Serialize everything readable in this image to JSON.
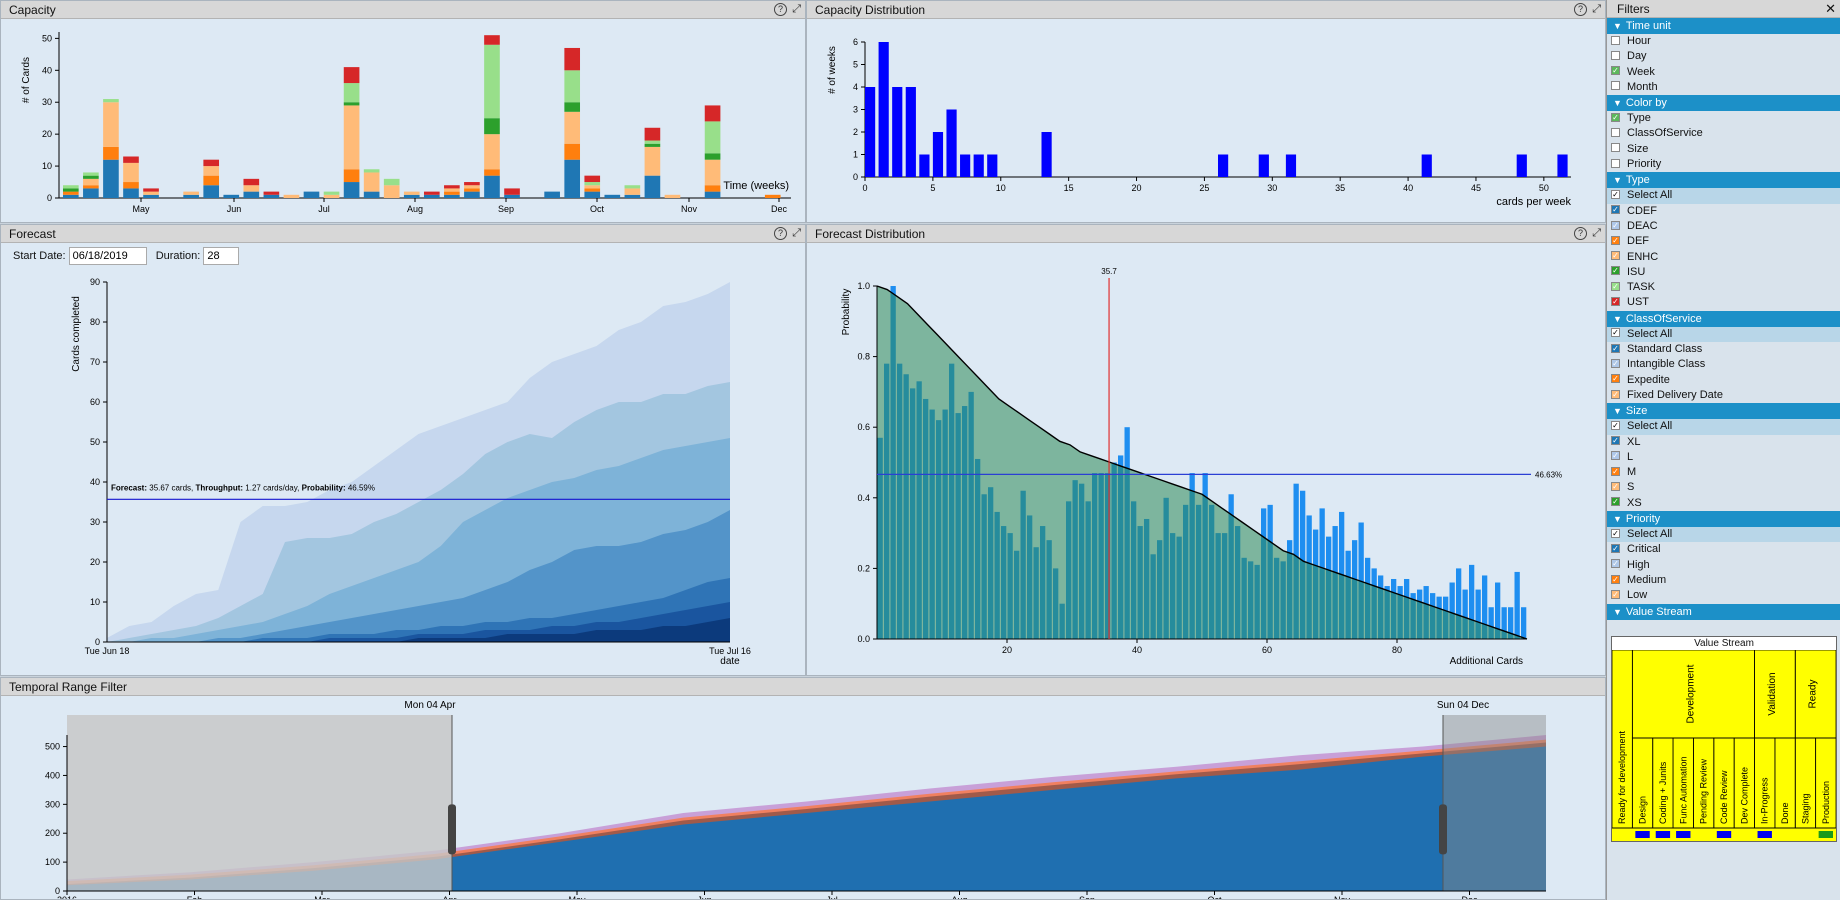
{
  "capacity": {
    "title": "Capacity",
    "ylabel": "# of Cards",
    "xlabel": "Time (weeks)",
    "yticks": [
      0,
      10,
      20,
      30,
      40,
      50
    ],
    "months": [
      "May",
      "Jun",
      "Jul",
      "Aug",
      "Sep",
      "Oct",
      "Nov",
      "Dec"
    ]
  },
  "capacity_distribution": {
    "title": "Capacity Distribution",
    "ylabel": "# of weeks",
    "xlabel": "cards per week",
    "xticks": [
      0,
      5,
      10,
      15,
      20,
      25,
      30,
      35,
      40,
      45,
      50
    ],
    "yticks": [
      0,
      1,
      2,
      3,
      4,
      5,
      6
    ]
  },
  "forecast": {
    "title": "Forecast",
    "start_date_label": "Start Date:",
    "start_date": "06/18/2019",
    "duration_label": "Duration:",
    "duration": "28",
    "ylabel": "Cards completed",
    "xlabel": "date",
    "x_start": "Tue Jun 18",
    "x_end": "Tue Jul 16",
    "yticks": [
      0,
      10,
      20,
      30,
      40,
      50,
      60,
      70,
      80,
      90
    ],
    "annotation": {
      "forecast_label": "Forecast:",
      "forecast_value": "35.67 cards,",
      "throughput_label": "Throughput:",
      "throughput_value": "1.27 cards/day,",
      "probability_label": "Probability:",
      "probability_value": "46.59%"
    }
  },
  "forecast_distribution": {
    "title": "Forecast Distribution",
    "ylabel": "Probability",
    "xlabel": "Additional Cards",
    "xticks": [
      20,
      40,
      60,
      80
    ],
    "yticks": [
      "0.0",
      "0.2",
      "0.4",
      "0.6",
      "0.8",
      "1.0"
    ],
    "marker_label": "35.7",
    "hline_label": "46.63%"
  },
  "temporal": {
    "title": "Temporal Range Filter",
    "range_start": "Mon 04 Apr",
    "range_end": "Sun 04 Dec",
    "yticks": [
      0,
      100,
      200,
      300,
      400,
      500
    ],
    "xticks": [
      "2016",
      "Feb",
      "Mar",
      "Apr",
      "May",
      "Jun",
      "Jul",
      "Aug",
      "Sep",
      "Oct",
      "Nov",
      "Dec"
    ]
  },
  "filters": {
    "title": "Filters",
    "groups": [
      {
        "title": "Time unit",
        "items": [
          {
            "label": "Hour",
            "color": "#ffffff"
          },
          {
            "label": "Day",
            "color": "#ffffff"
          },
          {
            "label": "Week",
            "color": "#5cb85c",
            "checked": true
          },
          {
            "label": "Month",
            "color": "#ffffff"
          }
        ]
      },
      {
        "title": "Color by",
        "items": [
          {
            "label": "Type",
            "color": "#5cb85c",
            "checked": true
          },
          {
            "label": "ClassOfService",
            "color": "#ffffff"
          },
          {
            "label": "Size",
            "color": "#ffffff"
          },
          {
            "label": "Priority",
            "color": "#ffffff"
          }
        ]
      },
      {
        "title": "Type",
        "items": [
          {
            "label": "Select All",
            "sel": true,
            "checked": true
          },
          {
            "label": "CDEF",
            "color": "#1f77b4",
            "checked": true
          },
          {
            "label": "DEAC",
            "color": "#aec7e8",
            "checked": true
          },
          {
            "label": "DEF",
            "color": "#ff7f0e",
            "checked": true
          },
          {
            "label": "ENHC",
            "color": "#ffbb78",
            "checked": true
          },
          {
            "label": "ISU",
            "color": "#2ca02c",
            "checked": true
          },
          {
            "label": "TASK",
            "color": "#98df8a",
            "checked": true
          },
          {
            "label": "UST",
            "color": "#d62728",
            "checked": true
          }
        ]
      },
      {
        "title": "ClassOfService",
        "items": [
          {
            "label": "Select All",
            "sel": true,
            "checked": true
          },
          {
            "label": "Standard Class",
            "color": "#1f77b4",
            "checked": true
          },
          {
            "label": "Intangible Class",
            "color": "#aec7e8",
            "checked": true
          },
          {
            "label": "Expedite",
            "color": "#ff7f0e",
            "checked": true
          },
          {
            "label": "Fixed Delivery Date",
            "color": "#ffbb78",
            "checked": true
          }
        ]
      },
      {
        "title": "Size",
        "items": [
          {
            "label": "Select All",
            "sel": true,
            "checked": true
          },
          {
            "label": "XL",
            "color": "#1f77b4",
            "checked": true
          },
          {
            "label": "L",
            "color": "#aec7e8",
            "checked": true
          },
          {
            "label": "M",
            "color": "#ff7f0e",
            "checked": true
          },
          {
            "label": "S",
            "color": "#ffbb78",
            "checked": true
          },
          {
            "label": "XS",
            "color": "#2ca02c",
            "checked": true
          }
        ]
      },
      {
        "title": "Priority",
        "items": [
          {
            "label": "Select All",
            "sel": true,
            "checked": true
          },
          {
            "label": "Critical",
            "color": "#1f77b4",
            "checked": true
          },
          {
            "label": "High",
            "color": "#aec7e8",
            "checked": true
          },
          {
            "label": "Medium",
            "color": "#ff7f0e",
            "checked": true
          },
          {
            "label": "Low",
            "color": "#ffbb78",
            "checked": true
          }
        ]
      },
      {
        "title": "Value Stream",
        "items": []
      }
    ]
  },
  "value_stream": {
    "title": "Value Stream",
    "groups": [
      "Development",
      "Validation",
      "Ready"
    ],
    "columns": [
      "Ready for development",
      "Design",
      "Coding + Junits",
      "Func Automation",
      "Pending Review",
      "Code Review",
      "Dev Complete",
      "In-Progress",
      "Done",
      "Staging",
      "Production"
    ],
    "markers": [
      0,
      1,
      1,
      1,
      0,
      1,
      0,
      1,
      0,
      0,
      2
    ]
  },
  "chart_data": [
    {
      "type": "bar",
      "title": "Capacity",
      "ylabel": "# of Cards",
      "xlabel": "Time (weeks)",
      "ylim": [
        0,
        52
      ],
      "series_names": [
        "CDEF",
        "DEF",
        "ENHC",
        "ISU",
        "TASK",
        "UST"
      ],
      "colors": [
        "#1f77b4",
        "#ff7f0e",
        "#ffbb78",
        "#2ca02c",
        "#98df8a",
        "#d62728"
      ],
      "weeks": [
        [
          1,
          1,
          0,
          1,
          1,
          0
        ],
        [
          3,
          1,
          2,
          1,
          1,
          0
        ],
        [
          12,
          4,
          14,
          0,
          1,
          0
        ],
        [
          3,
          2,
          6,
          0,
          0,
          2
        ],
        [
          1,
          0,
          1,
          0,
          0,
          1
        ],
        [
          0,
          0,
          0,
          0,
          0,
          0
        ],
        [
          1,
          0,
          1,
          0,
          0,
          0
        ],
        [
          4,
          3,
          3,
          0,
          0,
          2
        ],
        [
          1,
          0,
          0,
          0,
          0,
          0
        ],
        [
          2,
          0,
          2,
          0,
          0,
          2
        ],
        [
          1,
          0,
          0,
          0,
          0,
          1
        ],
        [
          0,
          0,
          1,
          0,
          0,
          0
        ],
        [
          2,
          0,
          0,
          0,
          0,
          0
        ],
        [
          0,
          0,
          1,
          0,
          1,
          0
        ],
        [
          5,
          4,
          20,
          1,
          6,
          5
        ],
        [
          2,
          0,
          6,
          0,
          1,
          0
        ],
        [
          0,
          0,
          4,
          0,
          2,
          0
        ],
        [
          1,
          0,
          1,
          0,
          0,
          0
        ],
        [
          1,
          0,
          0,
          0,
          0,
          1
        ],
        [
          1,
          1,
          1,
          0,
          0,
          1
        ],
        [
          2,
          1,
          1,
          0,
          0,
          1
        ],
        [
          7,
          2,
          11,
          5,
          23,
          3
        ],
        [
          1,
          0,
          0,
          0,
          0,
          2
        ],
        [
          0,
          0,
          0,
          0,
          0,
          0
        ],
        [
          2,
          0,
          0,
          0,
          0,
          0
        ],
        [
          12,
          5,
          10,
          3,
          10,
          7
        ],
        [
          2,
          1,
          1,
          0,
          1,
          2
        ],
        [
          1,
          0,
          0,
          0,
          0,
          0
        ],
        [
          1,
          0,
          2,
          0,
          1,
          0
        ],
        [
          7,
          0,
          9,
          1,
          1,
          4
        ],
        [
          0,
          0,
          1,
          0,
          0,
          0
        ],
        [
          0,
          0,
          0,
          0,
          0,
          0
        ],
        [
          2,
          2,
          8,
          2,
          10,
          5
        ],
        [
          0,
          0,
          0,
          0,
          0,
          0
        ],
        [
          0,
          0,
          0,
          0,
          0,
          0
        ],
        [
          0,
          1,
          0,
          0,
          0,
          0
        ]
      ]
    },
    {
      "type": "bar",
      "title": "Capacity Distribution",
      "ylabel": "# of weeks",
      "xlabel": "cards per week",
      "xlim": [
        0,
        52
      ],
      "ylim": [
        0,
        6
      ],
      "x": [
        0,
        1,
        2,
        3,
        4,
        5,
        6,
        7,
        8,
        9,
        13,
        26,
        29,
        31,
        41,
        48,
        51
      ],
      "values": [
        4,
        6,
        4,
        4,
        1,
        2,
        3,
        1,
        1,
        1,
        2,
        1,
        1,
        1,
        1,
        1,
        1
      ]
    },
    {
      "type": "area",
      "title": "Forecast",
      "ylabel": "Cards completed",
      "xlabel": "date",
      "ylim": [
        0,
        90
      ],
      "x": [
        0,
        1,
        2,
        3,
        4,
        5,
        6,
        7,
        8,
        9,
        10,
        11,
        12,
        13,
        14,
        15,
        16,
        17,
        18,
        19,
        20,
        21,
        22,
        23,
        24,
        25,
        26,
        27,
        28
      ],
      "bands": [
        [
          1,
          4,
          5,
          9,
          12,
          13,
          30,
          34,
          34,
          35,
          38,
          40,
          44,
          48,
          52,
          54,
          56,
          58,
          60,
          66,
          70,
          72,
          74,
          78,
          80,
          84,
          85,
          87,
          90
        ],
        [
          0,
          1,
          2,
          3,
          4,
          6,
          9,
          12,
          25,
          26,
          26,
          27,
          30,
          32,
          35,
          38,
          42,
          47,
          50,
          52,
          51,
          55,
          58,
          60,
          60,
          62,
          62,
          64,
          65
        ],
        [
          0,
          0,
          1,
          1,
          2,
          3,
          4,
          5,
          7,
          9,
          12,
          14,
          16,
          18,
          20,
          24,
          30,
          33,
          36,
          38,
          40,
          41,
          43,
          44,
          46,
          48,
          49,
          50,
          51
        ],
        [
          0,
          0,
          0,
          0,
          0,
          1,
          1,
          2,
          3,
          4,
          5,
          6,
          7,
          8,
          9,
          10,
          11,
          13,
          15,
          18,
          20,
          23,
          24,
          24,
          25,
          27,
          28,
          30,
          33
        ],
        [
          0,
          0,
          0,
          0,
          0,
          0,
          0,
          1,
          1,
          1,
          2,
          2,
          2,
          3,
          3,
          4,
          4,
          5,
          5,
          6,
          6,
          7,
          8,
          9,
          10,
          11,
          13,
          15,
          16
        ],
        [
          0,
          0,
          0,
          0,
          0,
          0,
          0,
          0,
          0,
          0,
          1,
          1,
          1,
          1,
          2,
          2,
          2,
          3,
          3,
          3,
          4,
          4,
          5,
          5,
          6,
          7,
          8,
          9,
          10
        ],
        [
          0,
          0,
          0,
          0,
          0,
          0,
          0,
          0,
          0,
          0,
          0,
          0,
          0,
          0,
          1,
          1,
          1,
          1,
          2,
          2,
          2,
          2,
          3,
          3,
          3,
          4,
          4,
          5,
          6
        ]
      ],
      "forecast_line": 35.67
    },
    {
      "type": "bar",
      "title": "Forecast Distribution",
      "ylabel": "Probability",
      "xlabel": "Additional Cards",
      "xlim": [
        0,
        85
      ],
      "ylim": [
        0,
        1
      ],
      "x_start": 1,
      "values": [
        0.57,
        0.78,
        1.0,
        0.78,
        0.75,
        0.71,
        0.73,
        0.68,
        0.65,
        0.62,
        0.65,
        0.78,
        0.64,
        0.66,
        0.7,
        0.51,
        0.41,
        0.43,
        0.36,
        0.32,
        0.3,
        0.25,
        0.42,
        0.35,
        0.26,
        0.32,
        0.28,
        0.2,
        0.1,
        0.39,
        0.45,
        0.44,
        0.39,
        0.47,
        0.47,
        0.47,
        0.5,
        0.52,
        0.6,
        0.39,
        0.32,
        0.34,
        0.24,
        0.28,
        0.4,
        0.3,
        0.29,
        0.38,
        0.47,
        0.38,
        0.47,
        0.38,
        0.3,
        0.3,
        0.41,
        0.32,
        0.23,
        0.22,
        0.21,
        0.37,
        0.38,
        0.23,
        0.22,
        0.28,
        0.44,
        0.42,
        0.35,
        0.31,
        0.37,
        0.29,
        0.32,
        0.36,
        0.25,
        0.28,
        0.33,
        0.23,
        0.2,
        0.18,
        0.15,
        0.17,
        0.15,
        0.17,
        0.13,
        0.14,
        0.15,
        0.13,
        0.12,
        0.12,
        0.16,
        0.2,
        0.14,
        0.21,
        0.14,
        0.18,
        0.09,
        0.16,
        0.09,
        0.09,
        0.19,
        0.09
      ],
      "cdf": [
        1.0,
        0.99,
        0.97,
        0.95,
        0.92,
        0.89,
        0.86,
        0.83,
        0.8,
        0.77,
        0.74,
        0.71,
        0.68,
        0.66,
        0.64,
        0.62,
        0.6,
        0.58,
        0.56,
        0.55,
        0.53,
        0.52,
        0.51,
        0.5,
        0.49,
        0.48,
        0.47,
        0.46,
        0.45,
        0.44,
        0.43,
        0.42,
        0.41,
        0.39,
        0.37,
        0.35,
        0.33,
        0.31,
        0.29,
        0.27,
        0.25,
        0.24,
        0.22,
        0.21,
        0.2,
        0.19,
        0.18,
        0.17,
        0.16,
        0.15,
        0.14,
        0.13,
        0.12,
        0.11,
        0.1,
        0.09,
        0.08,
        0.07,
        0.06,
        0.05,
        0.04,
        0.03,
        0.02,
        0.01,
        0.0
      ],
      "marker": 35.7,
      "hline": 0.4663
    },
    {
      "type": "area",
      "title": "Temporal Range Filter",
      "ylim": [
        0,
        540
      ],
      "x": [
        0,
        1,
        2,
        3,
        4,
        5,
        6,
        7,
        8,
        9,
        10,
        11,
        12
      ],
      "base": [
        20,
        40,
        70,
        110,
        170,
        230,
        270,
        310,
        350,
        390,
        420,
        465,
        500
      ],
      "top": [
        40,
        65,
        100,
        140,
        200,
        270,
        310,
        355,
        395,
        430,
        470,
        500,
        540
      ]
    }
  ]
}
